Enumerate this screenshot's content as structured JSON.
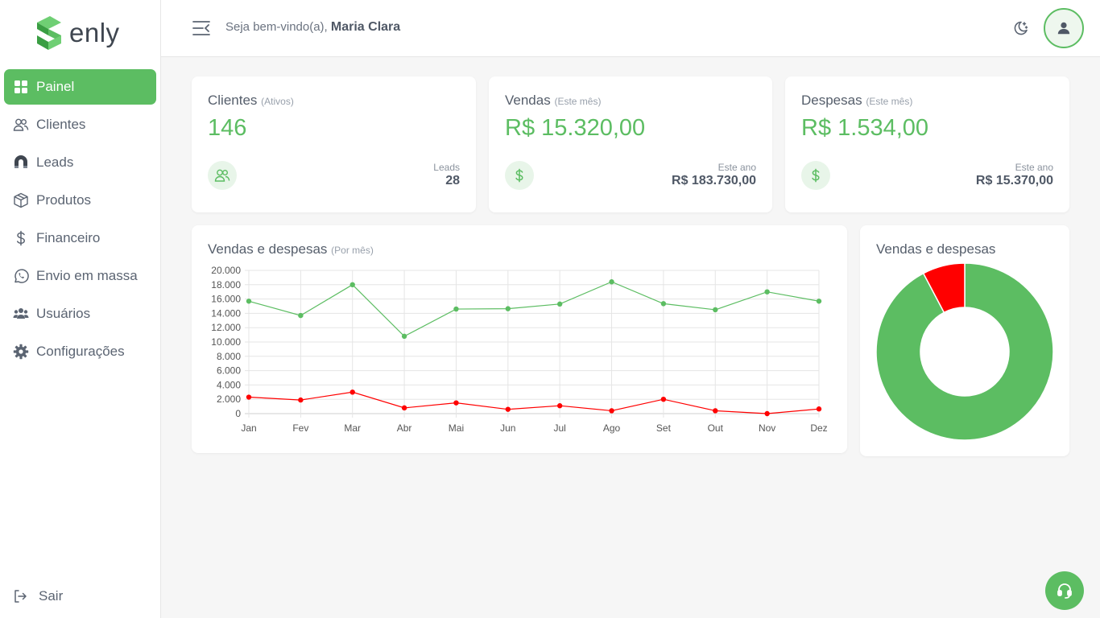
{
  "app": {
    "brand": "enly"
  },
  "colors": {
    "accent": "#5cbd62",
    "danger": "#ff0000"
  },
  "sidebar": {
    "items": [
      {
        "label": "Painel",
        "icon": "dashboard-icon"
      },
      {
        "label": "Clientes",
        "icon": "users-icon"
      },
      {
        "label": "Leads",
        "icon": "magnet-icon"
      },
      {
        "label": "Produtos",
        "icon": "box-icon"
      },
      {
        "label": "Financeiro",
        "icon": "dollar-icon"
      },
      {
        "label": "Envio em massa",
        "icon": "whatsapp-icon"
      },
      {
        "label": "Usuários",
        "icon": "users-group-icon"
      },
      {
        "label": "Configurações",
        "icon": "gear-icon"
      }
    ],
    "logout": "Sair"
  },
  "header": {
    "greeting": "Seja bem-vindo(a),",
    "user": "Maria Clara"
  },
  "cards": {
    "clientes": {
      "title": "Clientes",
      "qualifier": "(Ativos)",
      "value": "146",
      "sub_label": "Leads",
      "sub_value": "28"
    },
    "vendas": {
      "title": "Vendas",
      "qualifier": "(Este mês)",
      "value": "R$ 15.320,00",
      "sub_label": "Este ano",
      "sub_value": "R$ 183.730,00"
    },
    "despesas": {
      "title": "Despesas",
      "qualifier": "(Este mês)",
      "value": "R$ 1.534,00",
      "sub_label": "Este ano",
      "sub_value": "R$ 15.370,00"
    }
  },
  "chart_data": [
    {
      "type": "line",
      "title": "Vendas e despesas",
      "subtitle": "(Por mês)",
      "categories": [
        "Jan",
        "Fev",
        "Mar",
        "Abr",
        "Mai",
        "Jun",
        "Jul",
        "Ago",
        "Set",
        "Out",
        "Nov",
        "Dez"
      ],
      "series": [
        {
          "values": [
            15700,
            13700,
            18000,
            10800,
            14600,
            14650,
            15300,
            18400,
            15350,
            14500,
            17000,
            15700
          ],
          "color": "#5cbd62"
        },
        {
          "values": [
            2300,
            1900,
            3000,
            800,
            1500,
            600,
            1100,
            400,
            2000,
            400,
            0,
            650
          ],
          "color": "#ff0000"
        }
      ],
      "ylim": [
        0,
        20000
      ],
      "yticks": [
        "20.000",
        "18.000",
        "16.000",
        "14.000",
        "12.000",
        "10.000",
        "8.000",
        "6.000",
        "4.000",
        "2.000",
        "0"
      ],
      "grid": true
    },
    {
      "type": "pie",
      "title": "Vendas e despesas",
      "slices": [
        {
          "value": 183730,
          "color": "#5cbd62"
        },
        {
          "value": 15370,
          "color": "#ff0000"
        }
      ]
    }
  ]
}
